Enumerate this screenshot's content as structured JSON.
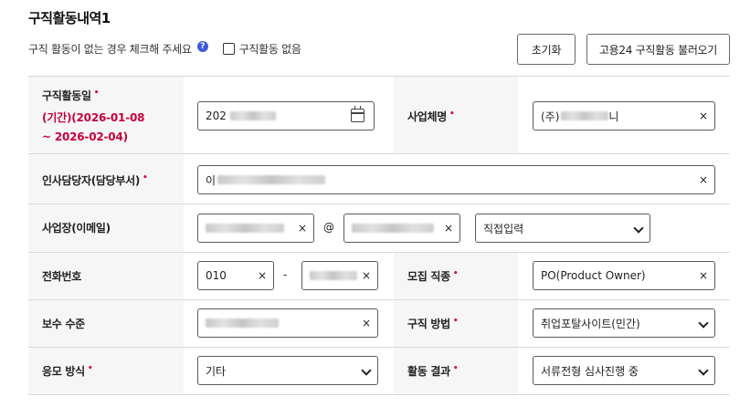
{
  "section_title": "구직활동내역1",
  "no_activity_notice": "구직 활동이 없는 경우 체크해 주세요",
  "no_activity_checkbox_label": "구직활동 없음",
  "help_icon": "question-circle-icon",
  "buttons": {
    "reset": "초기화",
    "load_goyong24": "고용24 구직활동 불러오기"
  },
  "required_mark": "•",
  "colors": {
    "required": "#d6004c",
    "period": "#c8003c",
    "help_icon": "#3b5bdb"
  },
  "rows": {
    "activity_date": {
      "label": "구직활동일",
      "period_line1": "(기간)(2026-01-08",
      "period_line2": "~ 2026-02-04)",
      "value_prefix": "202",
      "icon": "calendar-icon"
    },
    "company_name": {
      "label": "사업체명",
      "value_prefix": "(주)",
      "value_suffix": "니"
    },
    "hr_contact": {
      "label": "인사담당자(담당부서)",
      "value_prefix": "이"
    },
    "email": {
      "label": "사업장(이메일)",
      "at": "@",
      "domain_select": "직접입력"
    },
    "phone": {
      "label": "전화번호",
      "part1": "010",
      "dash": "-"
    },
    "job_type": {
      "label": "모집 직종",
      "value": "PO(Product Owner)"
    },
    "pay": {
      "label": "보수 수준"
    },
    "method": {
      "label": "구직 방법",
      "value": "취업포탈사이트(민간)"
    },
    "apply_method": {
      "label": "응모 방식",
      "value": "기타"
    },
    "result": {
      "label": "활동 결과",
      "value": "서류전형 심사진행 중"
    }
  },
  "clear_glyph": "×"
}
